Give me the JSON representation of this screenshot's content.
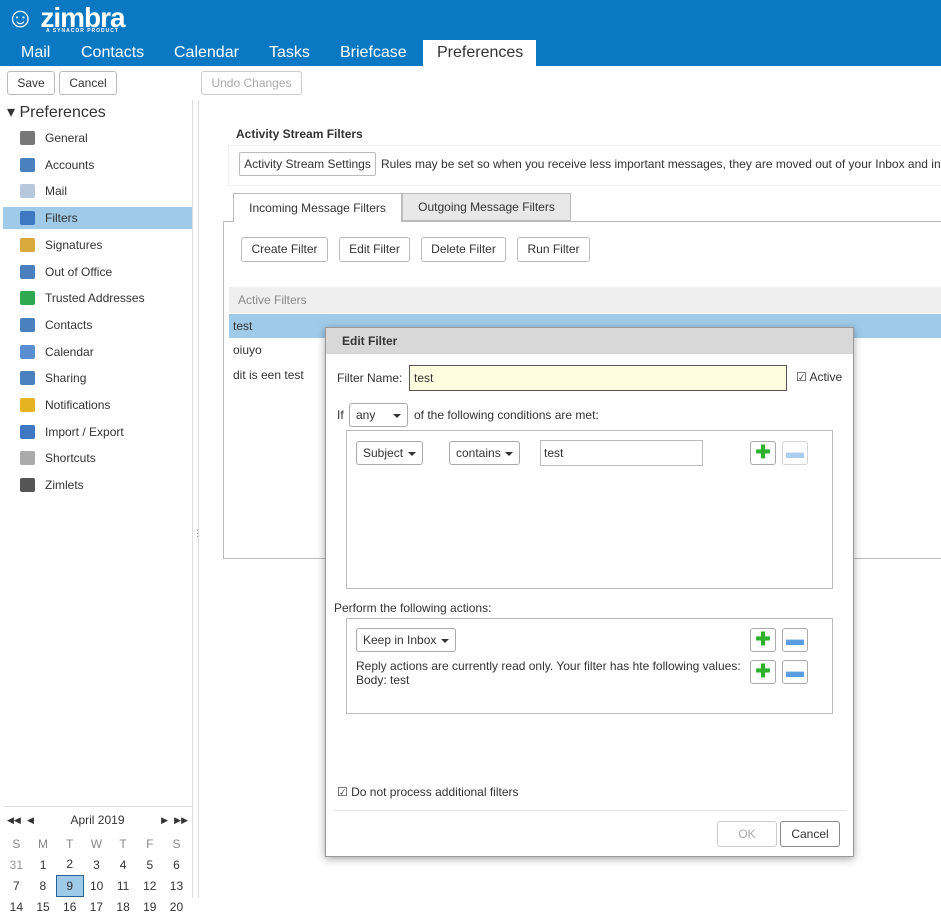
{
  "brand": {
    "name": "zimbra",
    "tagline": "A SYNACOR PRODUCT"
  },
  "apptabs": [
    "Mail",
    "Contacts",
    "Calendar",
    "Tasks",
    "Briefcase",
    "Preferences"
  ],
  "toolbar": {
    "save": "Save",
    "cancel": "Cancel",
    "undo": "Undo Changes"
  },
  "sidebar": {
    "title": "Preferences",
    "items": [
      {
        "label": "General",
        "icon": "gear-icon"
      },
      {
        "label": "Accounts",
        "icon": "accounts-icon"
      },
      {
        "label": "Mail",
        "icon": "envelope-icon"
      },
      {
        "label": "Filters",
        "icon": "filter-icon"
      },
      {
        "label": "Signatures",
        "icon": "signature-icon"
      },
      {
        "label": "Out of Office",
        "icon": "out-of-office-icon"
      },
      {
        "label": "Trusted Addresses",
        "icon": "shield-icon"
      },
      {
        "label": "Contacts",
        "icon": "contact-icon"
      },
      {
        "label": "Calendar",
        "icon": "calendar-icon"
      },
      {
        "label": "Sharing",
        "icon": "sharing-icon"
      },
      {
        "label": "Notifications",
        "icon": "bell-icon"
      },
      {
        "label": "Import / Export",
        "icon": "import-export-icon"
      },
      {
        "label": "Shortcuts",
        "icon": "keyboard-icon"
      },
      {
        "label": "Zimlets",
        "icon": "zimlet-icon"
      }
    ],
    "selected": "Filters"
  },
  "calendar": {
    "month": "April 2019",
    "days": [
      "S",
      "M",
      "T",
      "W",
      "T",
      "F",
      "S"
    ],
    "weeks": [
      [
        "31",
        "1",
        "2",
        "3",
        "4",
        "5",
        "6"
      ],
      [
        "7",
        "8",
        "9",
        "10",
        "11",
        "12",
        "13"
      ],
      [
        "14",
        "15",
        "16",
        "17",
        "18",
        "19",
        "20"
      ]
    ],
    "today": "9"
  },
  "activity": {
    "title": "Activity Stream Filters",
    "button": "Activity Stream Settings",
    "text": "Rules may be set so when you receive less important messages, they are moved out of your Inbox and in"
  },
  "filtertabs": [
    "Incoming Message Filters",
    "Outgoing Message Filters"
  ],
  "filterbuttons": [
    "Create Filter",
    "Edit Filter",
    "Delete Filter",
    "Run Filter"
  ],
  "active_filters": {
    "header": "Active Filters",
    "rows": [
      "test",
      "oiuyo",
      "dit is een test"
    ]
  },
  "dialog": {
    "title": "Edit Filter",
    "name_label": "Filter Name:",
    "name_value": "test",
    "active_label": "Active",
    "active": true,
    "if_label": "If",
    "match": "any",
    "conditions_text": "of the following conditions are met:",
    "condition": {
      "field": "Subject",
      "op": "contains",
      "value": "test"
    },
    "actions_label": "Perform the following actions:",
    "action": "Keep in Inbox",
    "reply_note": "Reply actions are currently read only. Your filter has hte following values:",
    "reply_body": "Body: test",
    "stop_label": "Do not process additional filters",
    "stop": true,
    "ok": "OK",
    "cancel": "Cancel"
  },
  "colors": {
    "brand": "#0a78c2",
    "selection": "#9fcbe9",
    "input_bg": "#fffde0"
  }
}
